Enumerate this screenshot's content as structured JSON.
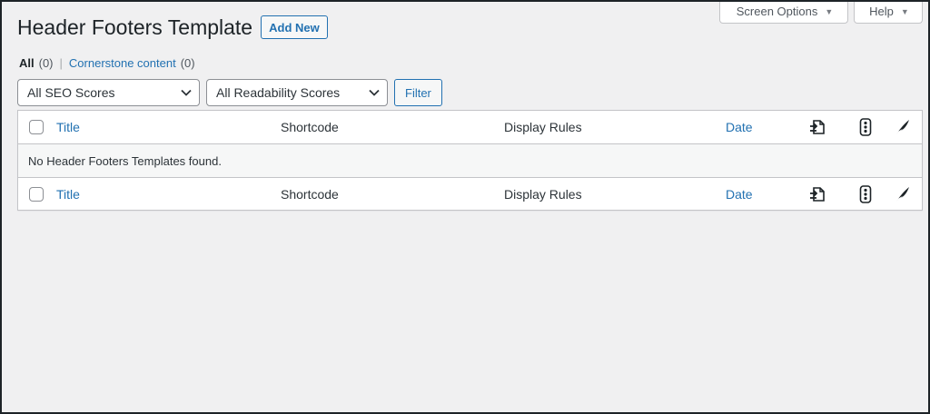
{
  "screen_meta": {
    "screen_options_label": "Screen Options",
    "help_label": "Help"
  },
  "page": {
    "title": "Header Footers Template",
    "add_new_label": "Add New"
  },
  "views": [
    {
      "label": "All",
      "count": "(0)"
    },
    {
      "label": "Cornerstone content",
      "count": "(0)"
    }
  ],
  "views_separator": "|",
  "filters": {
    "seo_selected": "All SEO Scores",
    "readability_selected": "All Readability Scores",
    "filter_button": "Filter"
  },
  "table": {
    "columns": {
      "title": "Title",
      "shortcode": "Shortcode",
      "display_rules": "Display Rules",
      "date": "Date"
    },
    "icons": [
      "internal-links-icon",
      "seo-score-icon",
      "readability-quill-icon"
    ],
    "empty_message": "No Header Footers Templates found."
  },
  "colors": {
    "link": "#2271b1",
    "background": "#f0f0f1",
    "border": "#c3c4c7"
  }
}
